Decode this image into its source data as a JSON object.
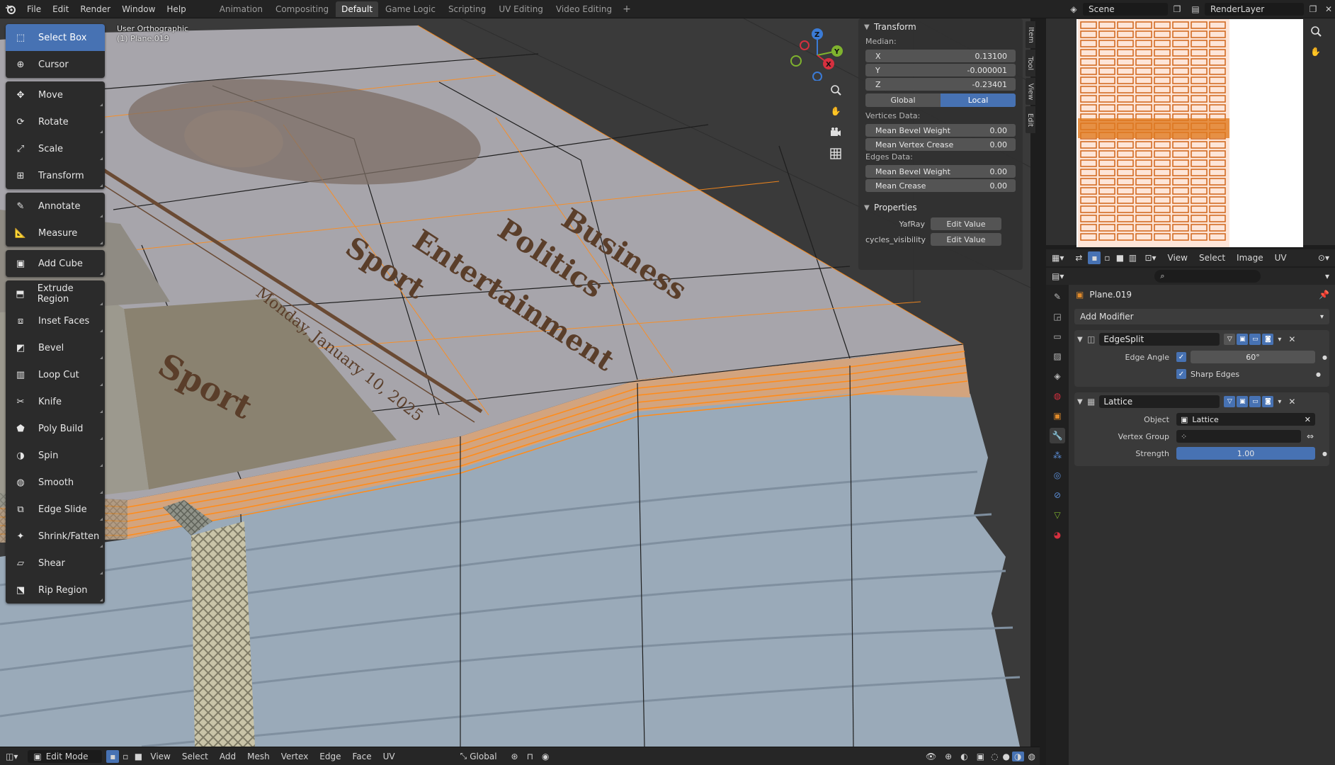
{
  "topbar": {
    "menus": [
      "File",
      "Edit",
      "Render",
      "Window",
      "Help"
    ],
    "workspaces": [
      "Animation",
      "Compositing",
      "Default",
      "Game Logic",
      "Scripting",
      "UV Editing",
      "Video Editing"
    ],
    "active_workspace": "Default",
    "scene": "Scene",
    "render_layer": "RenderLayer"
  },
  "viewport": {
    "view_name": "User Orthographic",
    "object_name": "(1) Plane.019",
    "tools": [
      {
        "label": "Select Box",
        "icon": "select-box-icon",
        "active": true
      },
      {
        "label": "Cursor",
        "icon": "cursor-icon"
      },
      {
        "label": "Move",
        "icon": "move-icon"
      },
      {
        "label": "Rotate",
        "icon": "rotate-icon"
      },
      {
        "label": "Scale",
        "icon": "scale-icon"
      },
      {
        "label": "Transform",
        "icon": "transform-icon"
      },
      {
        "label": "Annotate",
        "icon": "annotate-icon"
      },
      {
        "label": "Measure",
        "icon": "measure-icon"
      },
      {
        "label": "Add Cube",
        "icon": "add-cube-icon"
      },
      {
        "label": "Extrude Region",
        "icon": "extrude-icon"
      },
      {
        "label": "Inset Faces",
        "icon": "inset-icon"
      },
      {
        "label": "Bevel",
        "icon": "bevel-icon"
      },
      {
        "label": "Loop Cut",
        "icon": "loop-cut-icon"
      },
      {
        "label": "Knife",
        "icon": "knife-icon"
      },
      {
        "label": "Poly Build",
        "icon": "poly-build-icon"
      },
      {
        "label": "Spin",
        "icon": "spin-icon"
      },
      {
        "label": "Smooth",
        "icon": "smooth-icon"
      },
      {
        "label": "Edge Slide",
        "icon": "edge-slide-icon"
      },
      {
        "label": "Shrink/Fatten",
        "icon": "shrink-fatten-icon"
      },
      {
        "label": "Shear",
        "icon": "shear-icon"
      },
      {
        "label": "Rip Region",
        "icon": "rip-region-icon"
      }
    ],
    "newspaper_text": {
      "business": "Business",
      "politics": "Politics",
      "entertainment": "Entertainment",
      "sport": "Sport",
      "date": "Monday, January 10, 2025",
      "sport_box": "Sport"
    },
    "gizmo": {
      "x": "X",
      "y": "Y",
      "z": "Z"
    }
  },
  "npanel": {
    "transform_title": "Transform",
    "median_label": "Median:",
    "coords": [
      {
        "axis": "X",
        "value": "0.13100"
      },
      {
        "axis": "Y",
        "value": "-0.000001"
      },
      {
        "axis": "Z",
        "value": "-0.23401"
      }
    ],
    "space_global": "Global",
    "space_local": "Local",
    "vertices_data": "Vertices Data:",
    "mean_bevel_weight": {
      "label": "Mean Bevel Weight",
      "value": "0.00"
    },
    "mean_vertex_crease": {
      "label": "Mean Vertex Crease",
      "value": "0.00"
    },
    "edges_data": "Edges Data:",
    "edge_bevel_weight": {
      "label": "Mean Bevel Weight",
      "value": "0.00"
    },
    "mean_crease": {
      "label": "Mean Crease",
      "value": "0.00"
    },
    "properties_title": "Properties",
    "props": [
      {
        "label": "YafRay",
        "button": "Edit Value"
      },
      {
        "label": "cycles_visibility",
        "button": "Edit Value"
      }
    ],
    "tabs": [
      "Item",
      "Tool",
      "View",
      "Edit"
    ]
  },
  "vp_header": {
    "mode": "Edit Mode",
    "menus": [
      "View",
      "Select",
      "Add",
      "Mesh",
      "Vertex",
      "Edge",
      "Face",
      "UV"
    ],
    "orientation": "Global"
  },
  "uv_header": {
    "menus": [
      "View",
      "Select",
      "Image",
      "UV"
    ]
  },
  "properties": {
    "object_name": "Plane.019",
    "add_modifier": "Add Modifier",
    "modifiers": [
      {
        "name": "EdgeSplit",
        "edge_angle_label": "Edge Angle",
        "edge_angle": "60°",
        "sharp_edges": "Sharp Edges"
      },
      {
        "name": "Lattice",
        "object_label": "Object",
        "object_value": "Lattice",
        "vertex_group_label": "Vertex Group",
        "strength_label": "Strength",
        "strength": "1.00"
      }
    ]
  },
  "colors": {
    "accent": "#4772b3",
    "selected_edge": "#ff8c1a",
    "paper": "#a7a5ab"
  }
}
